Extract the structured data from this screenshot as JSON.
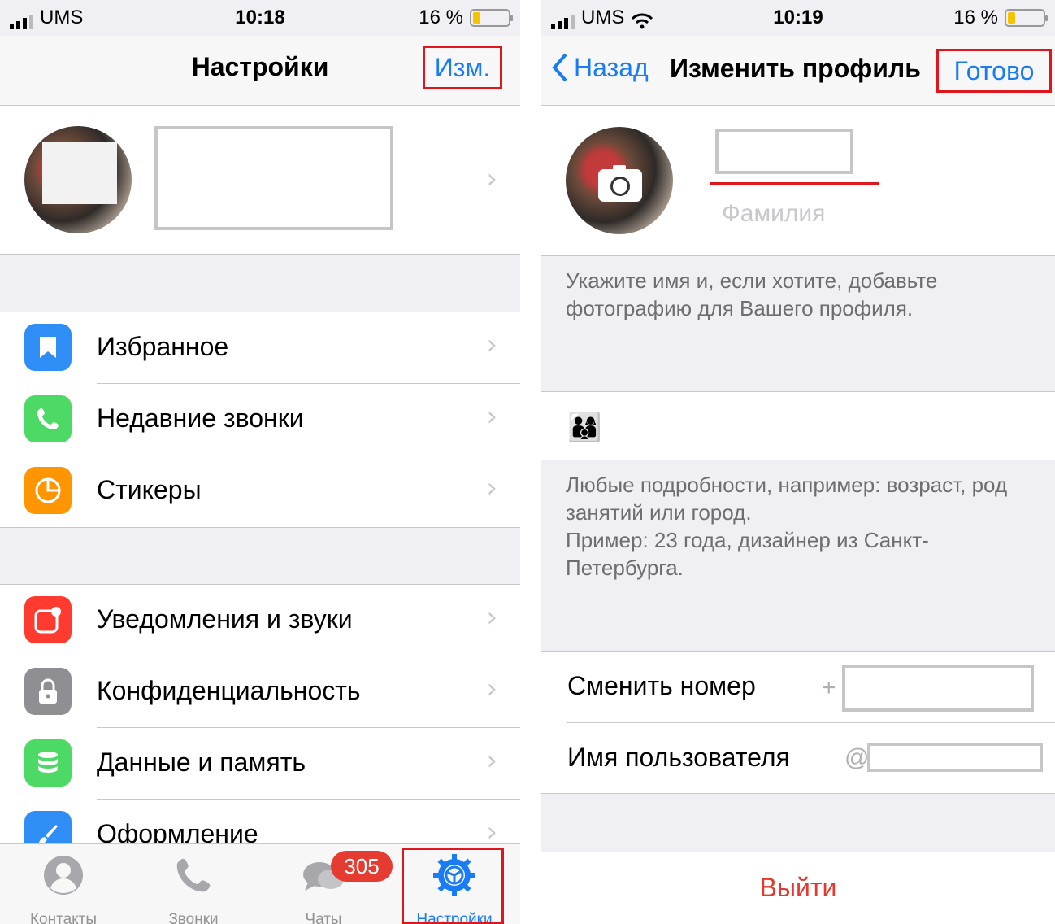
{
  "left_screen": {
    "status": {
      "carrier": "UMS",
      "time": "10:18",
      "battery": "16 %"
    },
    "nav": {
      "title": "Настройки",
      "edit_label": "Изм."
    },
    "menu_group_1": [
      {
        "label": "Избранное",
        "icon": "bookmark-icon",
        "color": "#2f8ef6"
      },
      {
        "label": "Недавние звонки",
        "icon": "phone-icon",
        "color": "#4cd964"
      },
      {
        "label": "Стикеры",
        "icon": "sticker-icon",
        "color": "#ff9500"
      }
    ],
    "menu_group_2": [
      {
        "label": "Уведомления и звуки",
        "icon": "notification-icon",
        "color": "#ff3b30"
      },
      {
        "label": "Конфиденциальность",
        "icon": "lock-icon",
        "color": "#8e8e93"
      },
      {
        "label": "Данные и память",
        "icon": "database-icon",
        "color": "#4cd964"
      },
      {
        "label": "Оформление",
        "icon": "brush-icon",
        "color": "#2f8ef6"
      }
    ],
    "tabs": [
      {
        "label": "Контакты",
        "icon": "contacts-icon"
      },
      {
        "label": "Звонки",
        "icon": "phone-icon"
      },
      {
        "label": "Чаты",
        "icon": "chats-icon",
        "badge": "305"
      },
      {
        "label": "Настройки",
        "icon": "settings-gear-icon",
        "active": true
      }
    ]
  },
  "right_screen": {
    "status": {
      "carrier": "UMS",
      "time": "10:19",
      "battery": "16 %"
    },
    "nav": {
      "back_label": "Назад",
      "title": "Изменить профиль",
      "done_label": "Готово"
    },
    "profile": {
      "last_name_placeholder": "Фамилия"
    },
    "name_hint": "Укажите имя и, если хотите, добавьте фотографию для Вашего профиля.",
    "bio": {
      "emoji": "👨‍👩‍👦"
    },
    "bio_hint_1": "Любые подробности, например: возраст, род занятий или город.",
    "bio_hint_2": "Пример: 23 года, дизайнер из Санкт-Петербурга.",
    "rows": [
      {
        "label": "Сменить номер",
        "prefix": "+"
      },
      {
        "label": "Имя пользователя",
        "prefix": "@"
      }
    ],
    "logout_label": "Выйти"
  },
  "colors": {
    "accent": "#1a7cf5",
    "highlight": "#e0161f",
    "destructive": "#e23a30",
    "badge": "#e63b30"
  }
}
